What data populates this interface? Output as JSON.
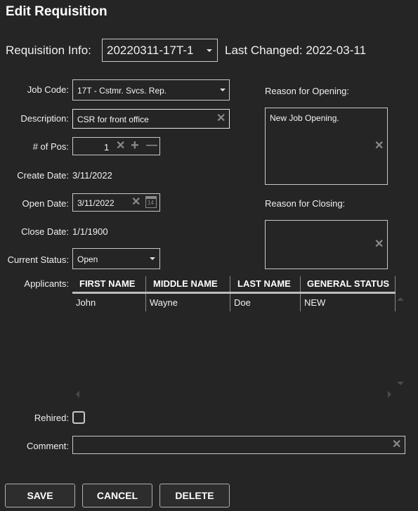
{
  "header": {
    "title": "Edit Requisition"
  },
  "requisition": {
    "label": "Requisition Info:",
    "selected": "20220311-17T-1",
    "last_changed_label": "Last Changed:",
    "last_changed_value": "2022-03-11"
  },
  "form": {
    "job_code": {
      "label": "Job Code:",
      "value": "17T - Cstmr. Svcs. Rep."
    },
    "description": {
      "label": "Description:",
      "value": "CSR for front office"
    },
    "num_pos": {
      "label": "# of Pos:",
      "value": "1"
    },
    "create_date": {
      "label": "Create Date:",
      "value": "3/11/2022"
    },
    "open_date": {
      "label": "Open Date:",
      "value": "3/11/2022",
      "calendar_day": "14"
    },
    "close_date": {
      "label": "Close Date:",
      "value": "1/1/1900"
    },
    "current_status": {
      "label": "Current Status:",
      "value": "Open"
    },
    "reason_opening": {
      "label": "Reason for Opening:",
      "value": "New Job Opening."
    },
    "reason_closing": {
      "label": "Reason for Closing:",
      "value": ""
    },
    "rehired": {
      "label": "Rehired:",
      "checked": false
    },
    "comment": {
      "label": "Comment:",
      "value": ""
    }
  },
  "applicants": {
    "label": "Applicants:",
    "columns": [
      "FIRST NAME",
      "MIDDLE NAME",
      "LAST NAME",
      "GENERAL STATUS"
    ],
    "rows": [
      [
        "John",
        "Wayne",
        "Doe",
        "NEW"
      ]
    ]
  },
  "buttons": {
    "save": "SAVE",
    "cancel": "CANCEL",
    "delete": "DELETE"
  },
  "icons": {
    "clear": "✕",
    "plus": "+",
    "minus": "—"
  }
}
